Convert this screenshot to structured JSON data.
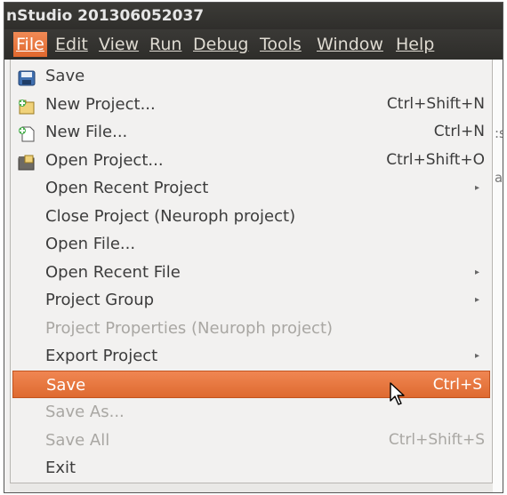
{
  "window": {
    "title": "nStudio 201306052037"
  },
  "menubar": {
    "items": [
      {
        "label": "File",
        "active": true
      },
      {
        "label": "Edit"
      },
      {
        "label": "View"
      },
      {
        "label": "Run"
      },
      {
        "label": "Debug"
      },
      {
        "label": "Tools"
      },
      {
        "label": "Window"
      },
      {
        "label": "Help"
      }
    ]
  },
  "background_fragments": [
    ":s",
    "al"
  ],
  "file_menu": {
    "items": [
      {
        "label": "Save",
        "shortcut": "",
        "icon": "save-icon",
        "enabled": true
      },
      {
        "label": "New Project...",
        "shortcut": "Ctrl+Shift+N",
        "icon": "new-project-icon",
        "enabled": true
      },
      {
        "label": "New File...",
        "shortcut": "Ctrl+N",
        "icon": "new-file-icon",
        "enabled": true
      },
      {
        "label": "Open Project...",
        "shortcut": "Ctrl+Shift+O",
        "icon": "open-project-icon",
        "enabled": true
      },
      {
        "label": "Open Recent Project",
        "shortcut": "",
        "submenu": true,
        "enabled": true
      },
      {
        "label": "Close Project (Neuroph project)",
        "shortcut": "",
        "enabled": true
      },
      {
        "label": "Open File...",
        "shortcut": "",
        "enabled": true
      },
      {
        "label": "Open Recent File",
        "shortcut": "",
        "submenu": true,
        "enabled": true
      },
      {
        "label": "Project Group",
        "shortcut": "",
        "submenu": true,
        "enabled": true
      },
      {
        "label": "Project Properties (Neuroph project)",
        "shortcut": "",
        "enabled": false
      },
      {
        "label": "Export Project",
        "shortcut": "",
        "submenu": true,
        "enabled": true
      },
      {
        "label": "Save",
        "shortcut": "Ctrl+S",
        "enabled": true,
        "highlighted": true
      },
      {
        "label": "Save As...",
        "shortcut": "",
        "enabled": false
      },
      {
        "label": "Save All",
        "shortcut": "Ctrl+Shift+S",
        "enabled": false
      },
      {
        "label": "Exit",
        "shortcut": "",
        "enabled": true
      }
    ],
    "submenu_arrow": "▸"
  },
  "colors": {
    "highlight": "#e9763d",
    "menubar": "#3c3b37",
    "menu_bg": "#f2f1f0",
    "disabled_text": "#a9a7a3"
  }
}
